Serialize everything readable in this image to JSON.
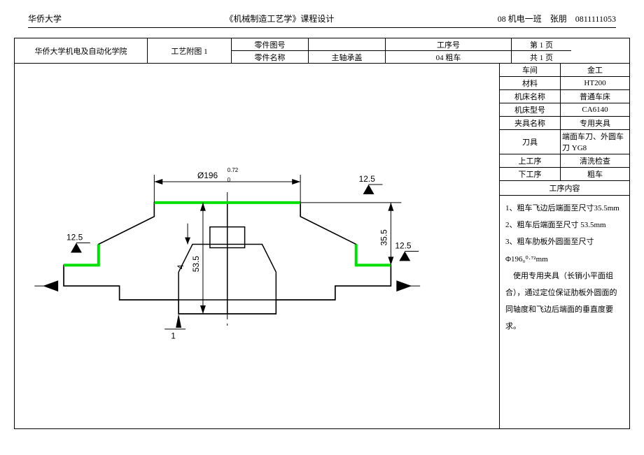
{
  "header": {
    "left": "华侨大学",
    "center": "《机械制造工艺学》课程设计",
    "right": "08 机电一班    张朋    0811111053"
  },
  "top": {
    "school": "华侨大学机电及自动化学院",
    "attach": "工艺附图 1",
    "part_no_label": "零件图号",
    "part_no_value": "",
    "proc_no_label": "工序号",
    "page1": "第 1 页",
    "part_name_label": "零件名称",
    "part_name_value": "主轴承盖",
    "proc_value": "04 粗车",
    "page2": "共 1 页"
  },
  "params": [
    {
      "label": "车间",
      "value": "金工"
    },
    {
      "label": "材料",
      "value": "HT200"
    },
    {
      "label": "机床名称",
      "value": "普通车床"
    },
    {
      "label": "机床型号",
      "value": "CA6140"
    },
    {
      "label": "夹具名称",
      "value": "专用夹具"
    },
    {
      "label": "刀具",
      "value": "端面车刀、外圆车刀 YG8"
    },
    {
      "label": "上工序",
      "value": "清洗检查"
    },
    {
      "label": "下工序",
      "value": "粗车"
    }
  ],
  "content": {
    "title": "工序内容",
    "lines": [
      "1、粗车飞边后端面至尺寸35.5mm",
      "2、粗车后端面至尺寸 53.5mm",
      "3、粗车肋板外圆面至尺寸Φ196₀⁰·⁷²mm",
      "　使用专用夹具（长销小平面组合），通过定位保证肋板外圆面的同轴度和飞边后端面的垂直度要求。"
    ]
  },
  "drawing": {
    "dia_label": "Ø196",
    "dia_sup": "0.72",
    "dia_sub": "0",
    "h1": "53.5",
    "h2": "35.5",
    "h3": "4",
    "ra": "12.5",
    "under": "1"
  }
}
